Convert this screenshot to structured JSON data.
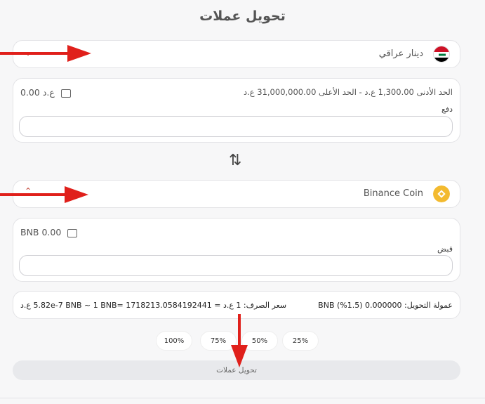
{
  "title": "تحويل عملات",
  "from": {
    "currency_name": "دينار عراقي",
    "flag_colors": [
      "#ce1126",
      "#ffffff",
      "#000000"
    ],
    "limits": "الحد الأدنى 1,300.00 ع.د - الحد الأعلى 31,000,000.00 ع.د",
    "balance": "ع.د 0.00",
    "field_label": "دفع",
    "input_value": ""
  },
  "to": {
    "currency_name": "Binance Coin",
    "icon_color": "#f3ba2f",
    "balance": "BNB 0.00",
    "field_label": "قبض",
    "input_value": ""
  },
  "rate": {
    "commission": "عمولة التحويل: 0.000000 BNB (%1.5)",
    "exchange": "سعر الصرف: 1 ع.د = 5.82e-7 BNB ~ 1 BNB= 1718213.0584192441 ع.د"
  },
  "percent_buttons": [
    "25%",
    "50%",
    "75%",
    "100%"
  ],
  "submit_label": "تحويل عملات",
  "annotation_color": "#e0201b"
}
